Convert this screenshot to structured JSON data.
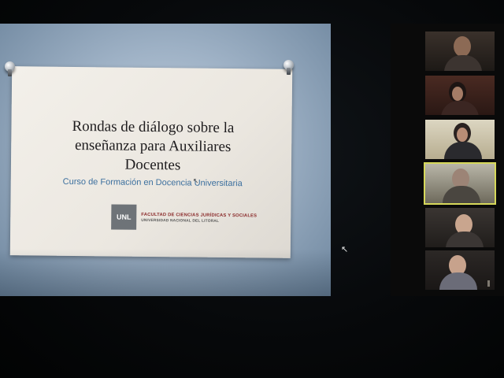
{
  "slide": {
    "title": "Rondas  de diálogo sobre la\nenseñanza para Auxiliares\nDocentes",
    "subtitle": "Curso de Formación en Docencia Universitaria",
    "logo_abbrev": "UNL",
    "logo_line1": "FACULTAD DE CIENCIAS JURÍDICAS Y SOCIALES",
    "logo_line2": "UNIVERSIDAD NACIONAL DEL LITORAL"
  },
  "colors": {
    "subtitle": "#3b6f9e",
    "logo_red": "#8a2a2a",
    "active_speaker_border": "#d6d85a"
  },
  "participants": [
    {
      "id": "p1",
      "active": false
    },
    {
      "id": "p2",
      "active": false
    },
    {
      "id": "p3",
      "active": false
    },
    {
      "id": "p4",
      "active": true
    },
    {
      "id": "p5",
      "active": false
    },
    {
      "id": "p6",
      "active": false
    }
  ],
  "icons": [
    "pushpin-icon",
    "mouse-pointer-icon"
  ]
}
